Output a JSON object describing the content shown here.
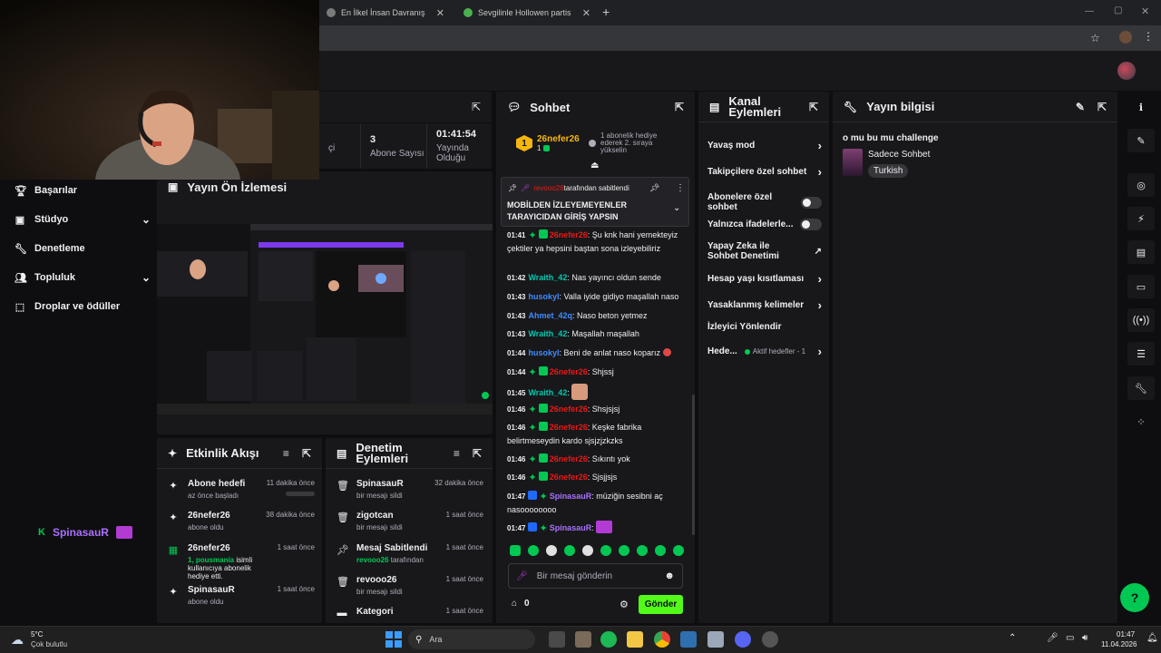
{
  "browser": {
    "tabs": [
      {
        "title": "En İlkel İnsan Davranışı? - Tier L"
      },
      {
        "title": "Sevgilinle Hollowen partisine ka"
      }
    ],
    "new_tab": "+"
  },
  "stats": [
    {
      "value": "",
      "label": "çi"
    },
    {
      "value": "3",
      "label": "Abone Sayısı"
    },
    {
      "value": "01:41:54",
      "label": "Yayında Olduğu"
    }
  ],
  "sidenav": {
    "items": [
      {
        "label": "Başarılar"
      },
      {
        "label": "Stüdyo"
      },
      {
        "label": "Denetleme"
      },
      {
        "label": "Topluluk"
      },
      {
        "label": "Droplar ve ödüller"
      }
    ]
  },
  "preview": {
    "title": "Yayın Ön İzlemesi"
  },
  "activity": {
    "title": "Etkinlik Akışı",
    "items": [
      {
        "title": "Abone hedefi",
        "sub": "az önce başladı",
        "time": "11 dakika önce"
      },
      {
        "title": "26nefer26",
        "sub": "abone oldu",
        "time": "38 dakika önce"
      },
      {
        "title": "26nefer26",
        "sub_highlight": "1, pousmania",
        "sub": " isimli kullanıcıya abonelik hediye etti.",
        "time": "1 saat önce"
      },
      {
        "title": "SpinasauR",
        "sub": "abone oldu",
        "time": "1 saat önce"
      }
    ]
  },
  "moderation": {
    "title": "Denetim Eylemleri",
    "items": [
      {
        "title": "SpinasauR",
        "sub": "bir mesajı sildi",
        "time": "32 dakika önce"
      },
      {
        "title": "zigotcan",
        "sub": "bir mesajı sildi",
        "time": "1 saat önce"
      },
      {
        "title": "Mesaj Sabitlendi",
        "sub_user": "revooo26",
        "sub": " tarafından",
        "time": "1 saat önce"
      },
      {
        "title": "revooo26",
        "sub": "bir mesajı sildi",
        "time": "1 saat önce"
      },
      {
        "title": "Kategori",
        "sub": "",
        "time": "1 saat önce"
      }
    ]
  },
  "overlay": {
    "name": "SpinasauR"
  },
  "chat": {
    "title": "Sohbet",
    "gifter": {
      "rank": "1",
      "name": "26nefer26",
      "count": "1",
      "note": "1 abonelik hediye ederek 2. sıraya yükselin"
    },
    "pinned": {
      "by_user": "revooo26",
      "by_text": " tarafından sabitlendi",
      "text": "MOBİLDEN İZLEYEMEYENLER TARAYICIDAN GİRİŞ YAPSIN"
    },
    "messages": [
      {
        "time": "01:41",
        "user": "26nefer26",
        "color": "#e91916",
        "text": ": Şu knk hani yemekteyiz çektiler ya hepsini baştan sona izleyebiliriz"
      },
      {
        "time": "01:42",
        "user": "Wraith_42",
        "color": "#00c8af",
        "text": ": Nas yayıncı oldun sende"
      },
      {
        "time": "01:43",
        "user": "husokyl",
        "color": "#3f8cff",
        "text": ": Valla iyide gidiyo maşallah naso"
      },
      {
        "time": "01:43",
        "user": "Ahmet_42q",
        "color": "#3f8cff",
        "text": ": Naso beton yetmez"
      },
      {
        "time": "01:43",
        "user": "Wraith_42",
        "color": "#00c8af",
        "text": ": Maşallah maşallah"
      },
      {
        "time": "01:44",
        "user": "husokyl",
        "color": "#3f8cff",
        "text": ": Beni de anlat naso koparız"
      },
      {
        "time": "01:44",
        "user": "26nefer26",
        "color": "#e91916",
        "text": ": Shjssj"
      },
      {
        "time": "01:45",
        "user": "Wraith_42",
        "color": "#00c8af",
        "text": ":"
      },
      {
        "time": "01:46",
        "user": "26nefer26",
        "color": "#e91916",
        "text": ": Shsjsjsj"
      },
      {
        "time": "01:46",
        "user": "26nefer26",
        "color": "#e91916",
        "text": ": Keşke fabrika belirtmeseydin kardo sjsjzjzkzks"
      },
      {
        "time": "01:46",
        "user": "26nefer26",
        "color": "#e91916",
        "text": ": Sıkıntı yok"
      },
      {
        "time": "01:46",
        "user": "26nefer26",
        "color": "#e91916",
        "text": ": Sjsjjsjs"
      },
      {
        "time": "01:47",
        "user": "SpinasauR",
        "color": "#a970ff",
        "text": ": müziğin sesibni aç nasoooooooo"
      },
      {
        "time": "01:47",
        "user": "SpinasauR",
        "color": "#a970ff",
        "text": ":"
      }
    ],
    "input_placeholder": "Bir mesaj gönderin",
    "points": "0",
    "send_label": "Gönder"
  },
  "channel_actions": {
    "title": "Kanal Eylemleri",
    "items": [
      {
        "label": "Yavaş mod"
      },
      {
        "label": "Takipçilere özel sohbet"
      },
      {
        "label": "Abonelere özel sohbet"
      },
      {
        "label": "Yalnızca ifadelerle..."
      },
      {
        "label": "Yapay Zeka ile Sohbet Denetimi"
      },
      {
        "label": "Hesap yaşı kısıtlaması"
      },
      {
        "label": "Yasaklanmış kelimeler"
      },
      {
        "label": "İzleyici Yönlendir"
      },
      {
        "label": "Hede...",
        "badge": "Aktif hedefler - 1"
      }
    ]
  },
  "stream_info": {
    "title": "Yayın bilgisi",
    "stream_title": "o mu bu mu challenge",
    "category": "Sadece Sohbet",
    "tag": "Turkish"
  },
  "taskbar": {
    "weather_temp": "5°C",
    "weather_text": "Çok bulutlu",
    "search_placeholder": "Ara",
    "clock_time": "01:47",
    "clock_date": "11.04.2026"
  },
  "colors": {
    "accent_green": "#00c853",
    "send_green": "#53fc18",
    "panel": "#18181b",
    "bg": "#0e0e10"
  }
}
